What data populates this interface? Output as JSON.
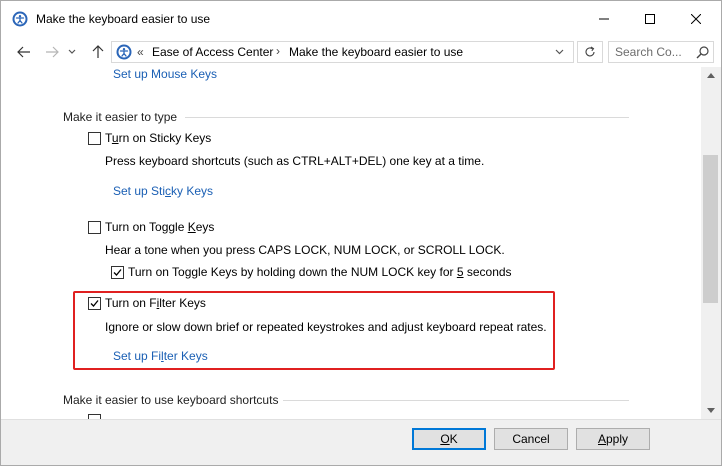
{
  "window": {
    "title": "Make the keyboard easier to use"
  },
  "navigation": {
    "breadcrumbs": [
      "Ease of Access Center",
      "Make the keyboard easier to use"
    ],
    "search_placeholder": "Search Co..."
  },
  "content": {
    "top_link": "Set up Mouse Keys",
    "section_type": {
      "heading": "Make it easier to type",
      "sticky": {
        "label_pre": "T",
        "label_key": "u",
        "label_post": "rn on Sticky Keys",
        "checked": false,
        "description": "Press keyboard shortcuts (such as CTRL+ALT+DEL) one key at a time.",
        "link_pre": "Set up Sti",
        "link_key": "c",
        "link_post": "ky Keys"
      },
      "toggle": {
        "label_pre": "Turn on Toggle ",
        "label_key": "K",
        "label_post": "eys",
        "checked": false,
        "description": "Hear a tone when you press CAPS LOCK, NUM LOCK, or SCROLL LOCK.",
        "sub_label_pre": "Turn on Toggle Keys by holding down the NUM LOCK key for ",
        "sub_label_key": "5",
        "sub_label_post": " seconds",
        "sub_checked": true
      },
      "filter": {
        "label_pre": "Turn on F",
        "label_key": "i",
        "label_post": "lter Keys",
        "checked": true,
        "description": "Ignore or slow down brief or repeated keystrokes and adjust keyboard repeat rates.",
        "link_pre": "Set up Fi",
        "link_key": "l",
        "link_post": "ter Keys"
      }
    },
    "section_shortcuts": {
      "heading": "Make it easier to use keyboard shortcuts"
    }
  },
  "footer": {
    "ok_key": "O",
    "ok_rest": "K",
    "cancel_label": "Cancel",
    "apply_key": "A",
    "apply_rest": "pply"
  },
  "colors": {
    "link": "#1a5fb4",
    "highlight": "#e02020",
    "default_button_border": "#0078d7"
  }
}
